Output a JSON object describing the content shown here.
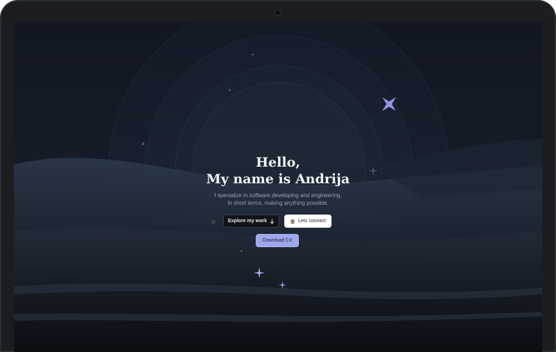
{
  "hero": {
    "greeting": "Hello,",
    "name_line": "My name is Andrija",
    "subtitle_line1": "I specialize in software developing and engineering.",
    "subtitle_line2": "In short terms, making anything possible."
  },
  "buttons": {
    "explore_label": "Explore my work",
    "explore_icon": "arrow-down-icon",
    "connect_label": "Lets connect",
    "connect_icon": "connect-avatar-icon",
    "cv_label": "Download CV"
  },
  "colors": {
    "accent": "#9ea6ee",
    "sparkle": "#8f97e6",
    "background": "#121722",
    "title": "#f2f4f8"
  }
}
